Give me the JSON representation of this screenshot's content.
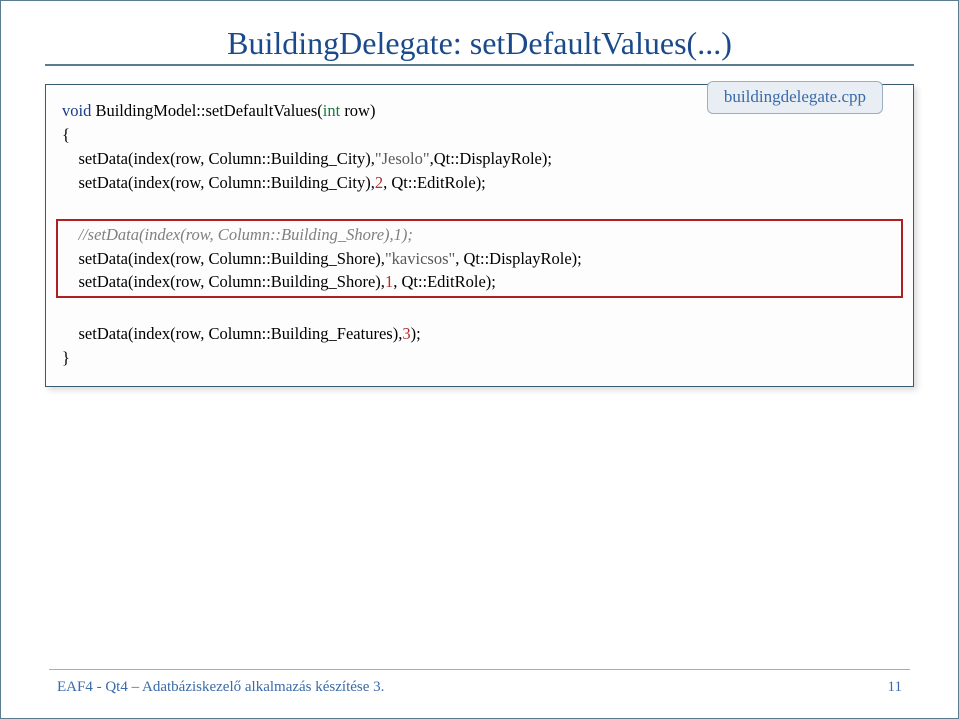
{
  "title": "BuildingDelegate: setDefaultValues(...)",
  "badge": "buildingdelegate.cpp",
  "code": {
    "l1_void": "void",
    "l1_rest": " BuildingModel::setDefaultValues(",
    "l1_int": "int",
    "l1_tail": " row)",
    "l2": "{",
    "l3a": "    setData(index(row, Column::Building_City),",
    "l3s": "\"Jesolo\"",
    "l3b": ",Qt::DisplayRole);",
    "l4a": "    setData(index(row, Column::Building_City),",
    "l4n": "2",
    "l4b": ", Qt::EditRole);",
    "blank1": " ",
    "l5": "    //setData(index(row, Column::Building_Shore),1);",
    "l6a": "    setData(index(row, Column::Building_Shore),",
    "l6s": "\"kavicsos\"",
    "l6b": ", Qt::DisplayRole);",
    "l7a": "    setData(index(row, Column::Building_Shore),",
    "l7n": "1",
    "l7b": ", Qt::EditRole);",
    "blank2": " ",
    "l8a": "    setData(index(row, Column::Building_Features),",
    "l8n": "3",
    "l8b": ");",
    "l9": "}"
  },
  "footer": "EAF4 - Qt4 – Adatbáziskezelő alkalmazás készítése 3.",
  "page": "11"
}
